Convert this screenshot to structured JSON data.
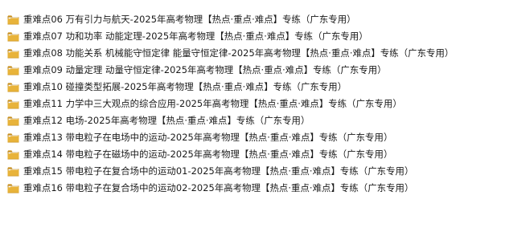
{
  "explorer": {
    "folder_color": "#E8B33A",
    "folder_icon": "folder-icon",
    "items": [
      {
        "name": "重难点06 万有引力与航天-2025年高考物理【热点·重点·难点】专练（广东专用）"
      },
      {
        "name": "重难点07 功和功率 动能定理-2025年高考物理【热点·重点·难点】专练（广东专用）"
      },
      {
        "name": "重难点08 功能关系 机械能守恒定律 能量守恒定律-2025年高考物理【热点·重点·难点】专练（广东专用）"
      },
      {
        "name": "重难点09 动量定理 动量守恒定律-2025年高考物理【热点·重点·难点】专练（广东专用）"
      },
      {
        "name": "重难点10 碰撞类型拓展-2025年高考物理【热点·重点·难点】专练（广东专用）"
      },
      {
        "name": "重难点11 力学中三大观点的综合应用-2025年高考物理【热点·重点·难点】专练（广东专用）"
      },
      {
        "name": "重难点12 电场-2025年高考物理【热点·重点·难点】专练（广东专用）"
      },
      {
        "name": "重难点13 带电粒子在电场中的运动-2025年高考物理【热点·重点·难点】专练（广东专用）"
      },
      {
        "name": "重难点14 带电粒子在磁场中的运动-2025年高考物理【热点·重点·难点】专练（广东专用）"
      },
      {
        "name": "重难点15 带电粒子在复合场中的运动01-2025年高考物理【热点·重点·难点】专练（广东专用）"
      },
      {
        "name": "重难点16 带电粒子在复合场中的运动02-2025年高考物理【热点·重点·难点】专练（广东专用）"
      }
    ]
  }
}
